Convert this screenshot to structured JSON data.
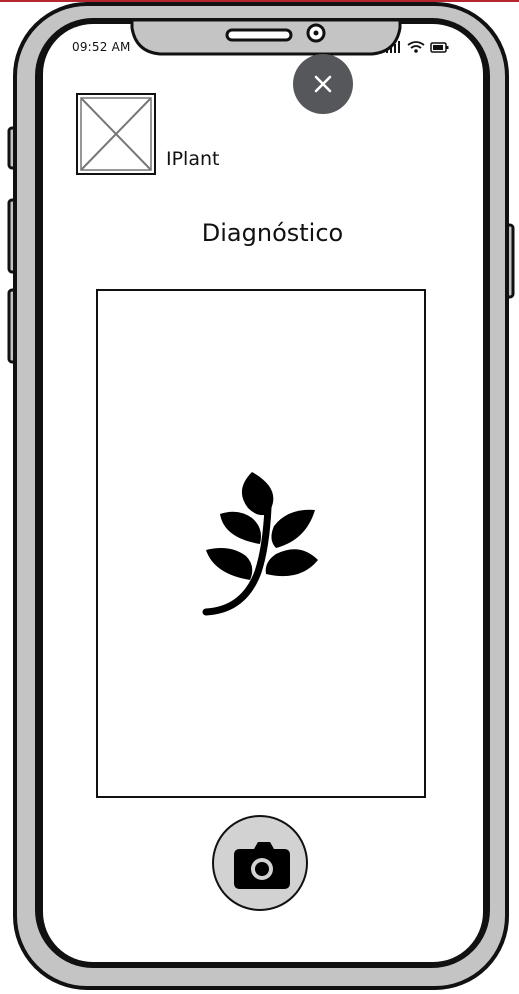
{
  "status_bar": {
    "time": "09:52 AM",
    "icons": [
      "signal-icon",
      "wifi-icon",
      "battery-icon"
    ]
  },
  "header": {
    "close_icon": "close-icon",
    "logo_icon": "image-placeholder-icon",
    "app_name": "IPlant"
  },
  "main": {
    "title": "Diagnóstico",
    "preview_icon": "leaf-icon",
    "capture_icon": "camera-icon"
  },
  "colors": {
    "top_accent": "#b5262e",
    "device_frame": "#c4c4c4",
    "close_button": "#55575a",
    "capture_button": "#d2d2d2",
    "ink": "#111111"
  }
}
